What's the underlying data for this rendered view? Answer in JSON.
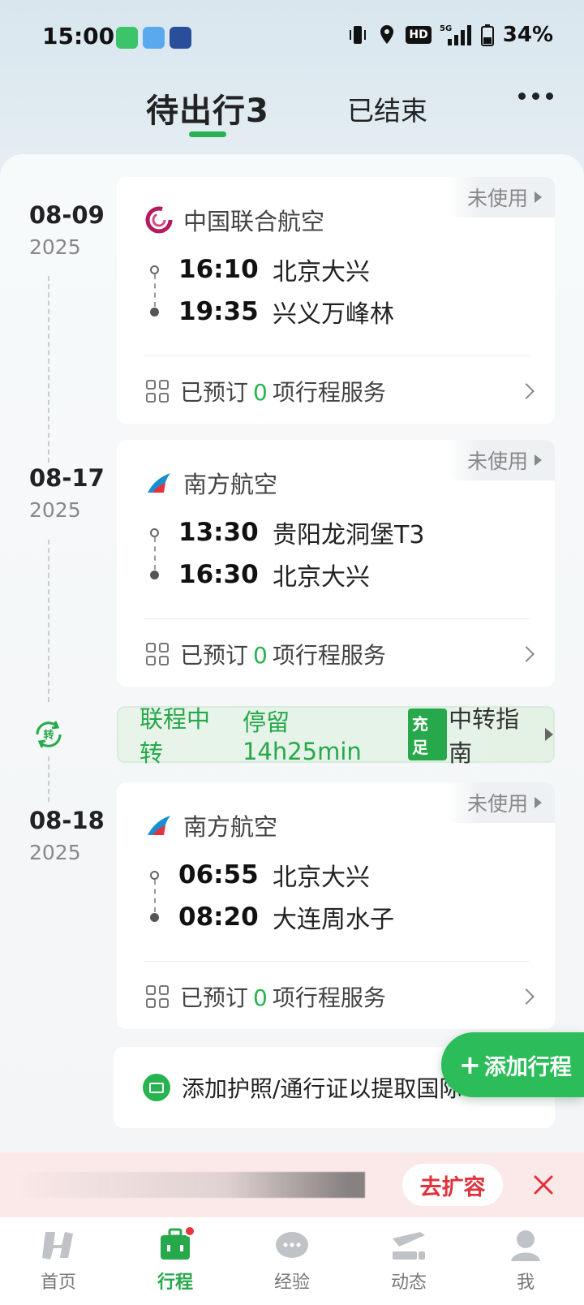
{
  "status_bar": {
    "time": "15:00",
    "hd": "HD",
    "network": "5G",
    "battery": "34%"
  },
  "header": {
    "tab_active": "待出行3",
    "tab_inactive": "已结束",
    "more": "more-icon"
  },
  "trips": [
    {
      "date": "08-09",
      "year": "2025",
      "airline": "中国联合航空",
      "status": "未使用",
      "depart_time": "16:10",
      "depart_place": "北京大兴",
      "arrive_time": "19:35",
      "arrive_place": "兴义万峰林",
      "service_prefix": "已预订",
      "service_count": "0",
      "service_suffix": "项行程服务"
    },
    {
      "date": "08-17",
      "year": "2025",
      "airline": "南方航空",
      "status": "未使用",
      "depart_time": "13:30",
      "depart_place": "贵阳龙洞堡T3",
      "arrive_time": "16:30",
      "arrive_place": "北京大兴",
      "service_prefix": "已预订",
      "service_count": "0",
      "service_suffix": "项行程服务"
    },
    {
      "date": "08-18",
      "year": "2025",
      "airline": "南方航空",
      "status": "未使用",
      "depart_time": "06:55",
      "depart_place": "北京大兴",
      "arrive_time": "08:20",
      "arrive_place": "大连周水子",
      "service_prefix": "已预订",
      "service_count": "0",
      "service_suffix": "项行程服务"
    }
  ],
  "transfer": {
    "label": "联程中转",
    "stay": "停留14h25min",
    "badge": "充足",
    "guide": "中转指南"
  },
  "passport": {
    "text": "添加护照/通行证以提取国际"
  },
  "add_trip": "添加行程",
  "promo": {
    "action": "去扩容"
  },
  "nav": [
    {
      "label": "首页",
      "icon": "home-icon"
    },
    {
      "label": "行程",
      "icon": "trip-icon"
    },
    {
      "label": "经验",
      "icon": "experience-icon"
    },
    {
      "label": "动态",
      "icon": "flight-status-icon"
    },
    {
      "label": "我",
      "icon": "profile-icon"
    }
  ],
  "colors": {
    "accent": "#27b34f",
    "promo_red": "#e0323c"
  }
}
